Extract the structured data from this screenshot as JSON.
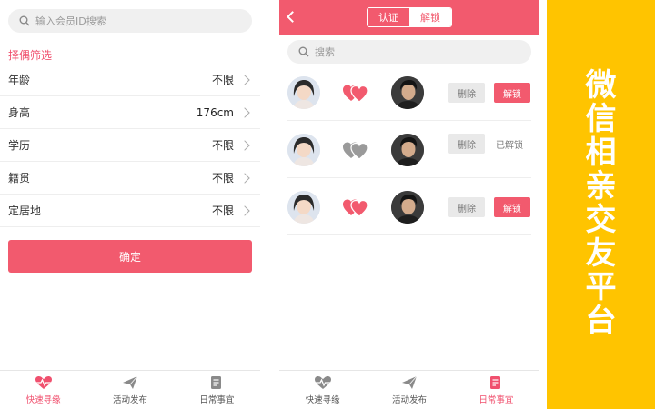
{
  "left": {
    "search": {
      "placeholder": "输入会员ID搜索"
    },
    "section_title": "择偶筛选",
    "filters": [
      {
        "label": "年龄",
        "value": "不限"
      },
      {
        "label": "身高",
        "value": "176cm"
      },
      {
        "label": "学历",
        "value": "不限"
      },
      {
        "label": "籍贯",
        "value": "不限"
      },
      {
        "label": "定居地",
        "value": "不限"
      }
    ],
    "confirm_label": "确定",
    "tabs": [
      {
        "label": "快速寻缘",
        "icon": "heartbeat-icon",
        "active": true
      },
      {
        "label": "活动发布",
        "icon": "paper-plane-icon",
        "active": false
      },
      {
        "label": "日常事宜",
        "icon": "document-edit-icon",
        "active": false
      }
    ]
  },
  "middle": {
    "segment": {
      "left": "认证",
      "right": "解锁"
    },
    "search": {
      "placeholder": "搜索"
    },
    "matches": [
      {
        "status": "locked",
        "delete_label": "删除",
        "action_label": "解锁",
        "heart_color": "#f25a6e"
      },
      {
        "status": "unlocked",
        "delete_label": "删除",
        "action_label": "已解锁",
        "heart_color": "#9a9a9a"
      },
      {
        "status": "locked",
        "delete_label": "删除",
        "action_label": "解锁",
        "heart_color": "#f25a6e"
      }
    ],
    "tabs": [
      {
        "label": "快速寻缘",
        "icon": "heartbeat-icon",
        "active": false
      },
      {
        "label": "活动发布",
        "icon": "paper-plane-icon",
        "active": false
      },
      {
        "label": "日常事宜",
        "icon": "document-edit-icon",
        "active": true
      }
    ]
  },
  "banner": {
    "text": "微信相亲交友平台"
  },
  "colors": {
    "accent": "#f25a6e",
    "banner_bg": "#ffc400",
    "inactive": "#9a9a9a"
  }
}
